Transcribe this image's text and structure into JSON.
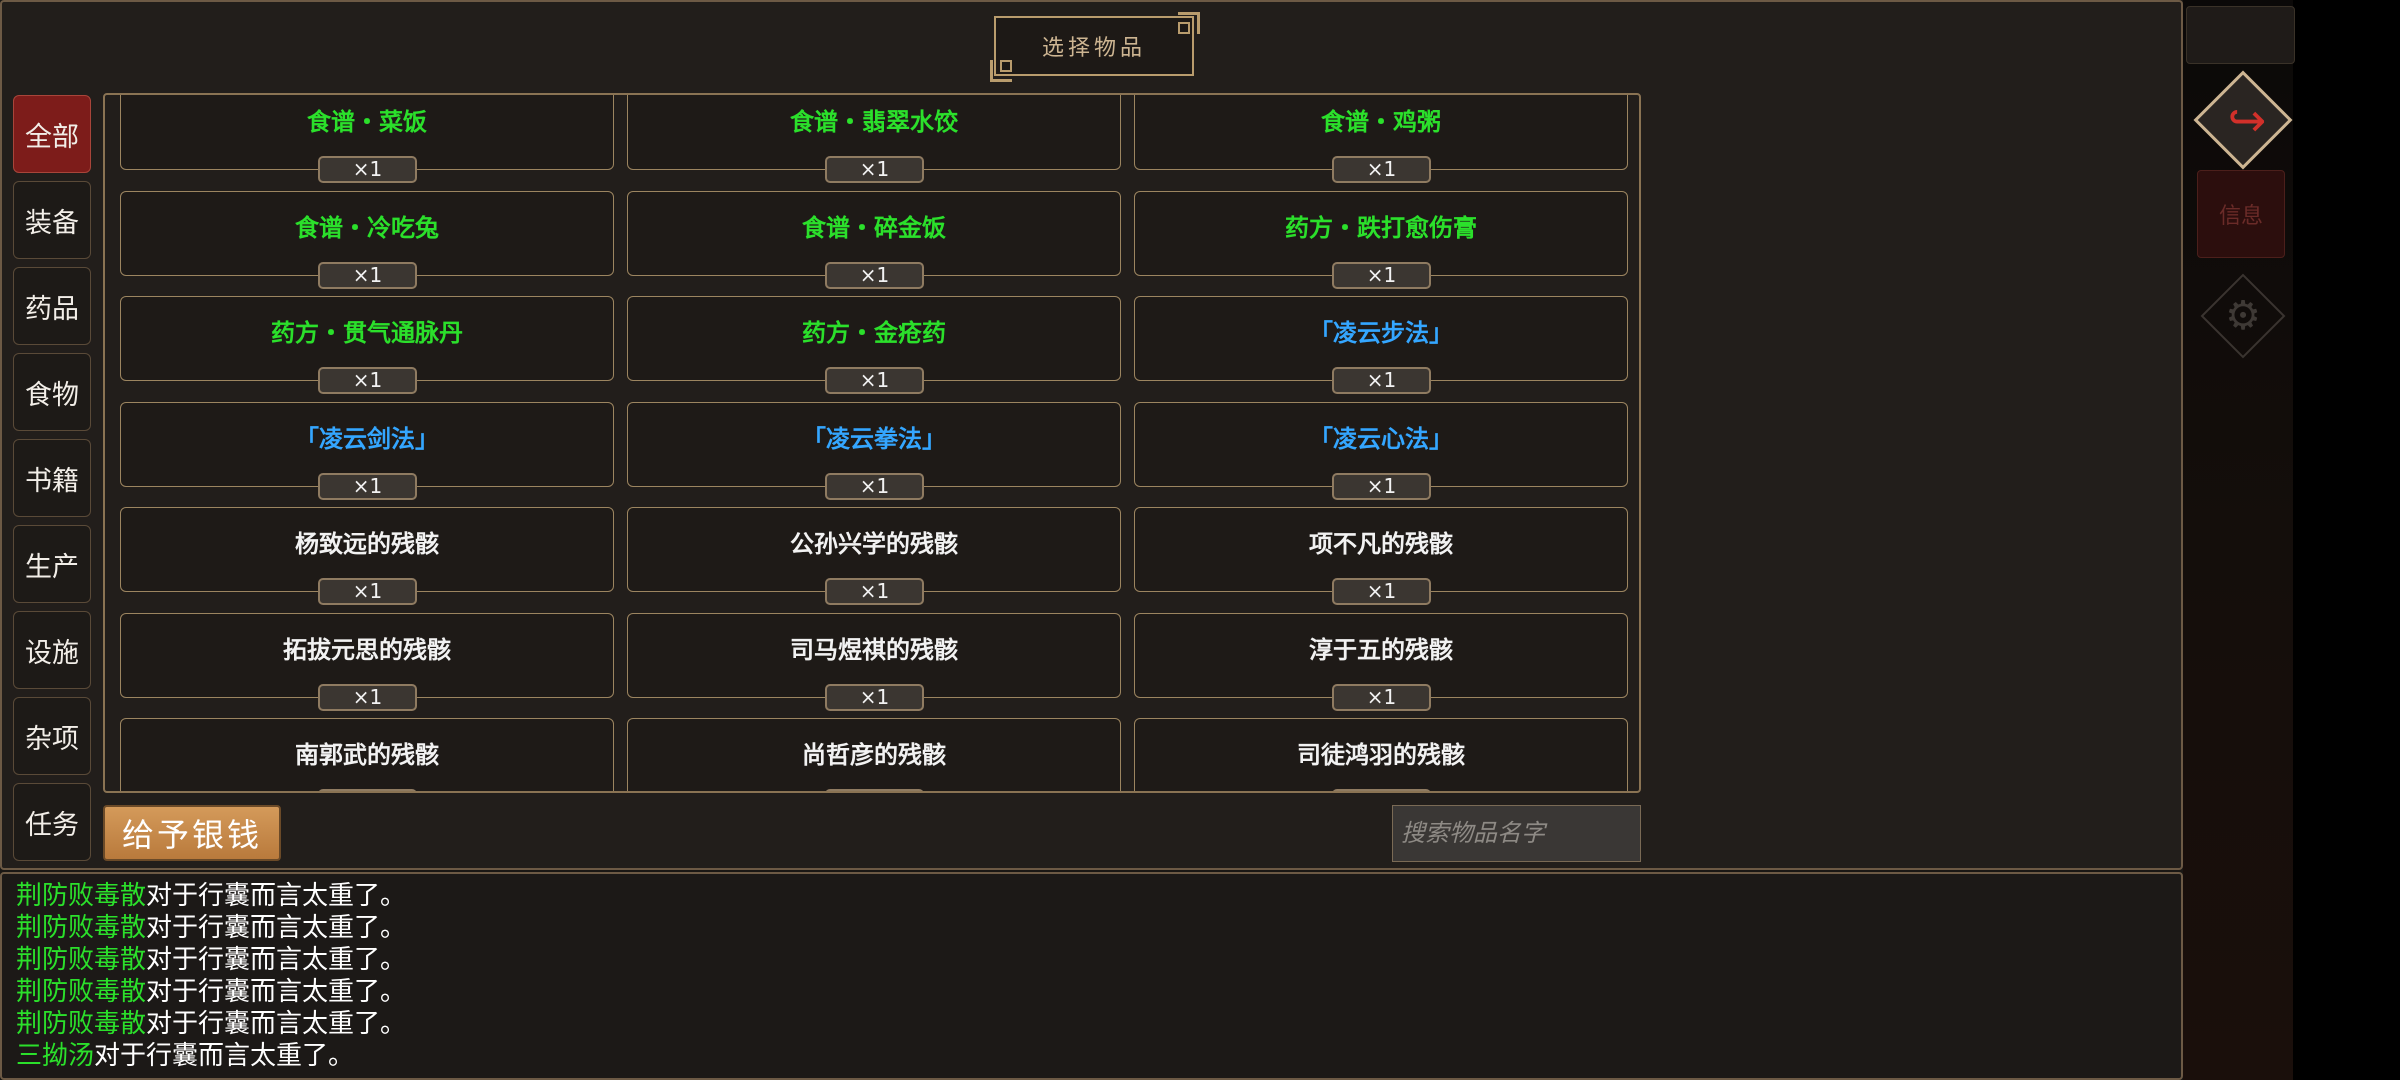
{
  "header": {
    "title": "选择物品"
  },
  "categories": [
    "全部",
    "装备",
    "药品",
    "食物",
    "书籍",
    "生产",
    "设施",
    "杂项",
    "任务"
  ],
  "items": [
    {
      "name": "食谱・菜饭",
      "qty": "×1",
      "color": "#2be02b"
    },
    {
      "name": "食谱・翡翠水饺",
      "qty": "×1",
      "color": "#2be02b"
    },
    {
      "name": "食谱・鸡粥",
      "qty": "×1",
      "color": "#2be02b"
    },
    {
      "name": "食谱・冷吃兔",
      "qty": "×1",
      "color": "#2be02b"
    },
    {
      "name": "食谱・碎金饭",
      "qty": "×1",
      "color": "#2be02b"
    },
    {
      "name": "药方・跌打愈伤膏",
      "qty": "×1",
      "color": "#2be02b"
    },
    {
      "name": "药方・贯气通脉丹",
      "qty": "×1",
      "color": "#2be02b"
    },
    {
      "name": "药方・金疮药",
      "qty": "×1",
      "color": "#2be02b"
    },
    {
      "name": "「凌云步法」",
      "qty": "×1",
      "color": "#34a6ff"
    },
    {
      "name": "「凌云剑法」",
      "qty": "×1",
      "color": "#34a6ff"
    },
    {
      "name": "「凌云拳法」",
      "qty": "×1",
      "color": "#34a6ff"
    },
    {
      "name": "「凌云心法」",
      "qty": "×1",
      "color": "#34a6ff"
    },
    {
      "name": "杨致远的残骸",
      "qty": "×1",
      "color": "#f2f2f2"
    },
    {
      "name": "公孙兴学的残骸",
      "qty": "×1",
      "color": "#f2f2f2"
    },
    {
      "name": "项不凡的残骸",
      "qty": "×1",
      "color": "#f2f2f2"
    },
    {
      "name": "拓拔元思的残骸",
      "qty": "×1",
      "color": "#f2f2f2"
    },
    {
      "name": "司马煜祺的残骸",
      "qty": "×1",
      "color": "#f2f2f2"
    },
    {
      "name": "淳于五的残骸",
      "qty": "×1",
      "color": "#f2f2f2"
    },
    {
      "name": "南郭武的残骸",
      "qty": "",
      "color": "#f2f2f2"
    },
    {
      "name": "尚哲彦的残骸",
      "qty": "",
      "color": "#f2f2f2"
    },
    {
      "name": "司徒鸿羽的残骸",
      "qty": "",
      "color": "#f2f2f2"
    }
  ],
  "footer": {
    "give_money_label": "给予银钱",
    "search_placeholder": "搜索物品名字"
  },
  "log": [
    {
      "item": "荆防败毒散",
      "text": "对于行囊而言太重了。"
    },
    {
      "item": "荆防败毒散",
      "text": "对于行囊而言太重了。"
    },
    {
      "item": "荆防败毒散",
      "text": "对于行囊而言太重了。"
    },
    {
      "item": "荆防败毒散",
      "text": "对于行囊而言太重了。"
    },
    {
      "item": "荆防败毒散",
      "text": "对于行囊而言太重了。"
    },
    {
      "item": "三拗汤",
      "text": "对于行囊而言太重了。"
    }
  ],
  "side": {
    "info_label": "信息"
  },
  "colors": {
    "accent_red": "#7d1c1a",
    "gold": "#b99c6d",
    "item_green": "#2be02b",
    "item_blue": "#34a6ff"
  }
}
